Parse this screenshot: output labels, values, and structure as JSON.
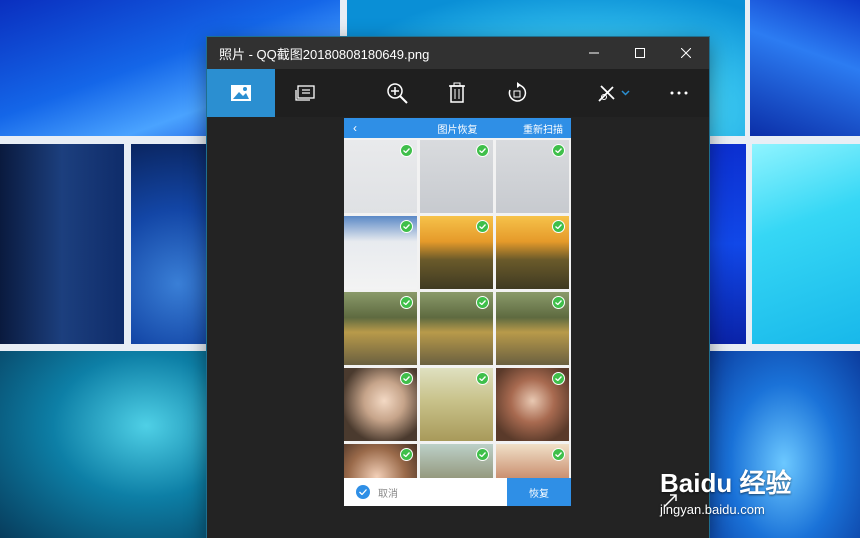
{
  "window": {
    "title": "照片 - QQ截图20180808180649.png",
    "controls": [
      "minimize",
      "maximize",
      "close"
    ]
  },
  "toolbar": {
    "items": [
      {
        "name": "photo-icon",
        "active": true
      },
      {
        "name": "slideshow-icon",
        "active": false
      },
      {
        "name": "zoom-in-icon",
        "active": false
      },
      {
        "name": "delete-icon",
        "active": false
      },
      {
        "name": "rotate-icon",
        "active": false
      },
      {
        "name": "edit-create-icon",
        "active": false
      },
      {
        "name": "more-icon",
        "active": false
      }
    ]
  },
  "phone": {
    "header": {
      "back": "‹",
      "title": "图片恢复",
      "rescan": "重新扫描"
    },
    "footer": {
      "cancel": "取消",
      "restore": "恢复"
    },
    "grid": [
      "img-ui1",
      "img-ui2",
      "img-ui2",
      "img-ui3",
      "img-sunset",
      "img-sunset",
      "img-car",
      "img-car",
      "img-car",
      "img-girl1",
      "img-wheat",
      "img-girl2",
      "img-girl3",
      "img-girl4",
      "img-girl5"
    ]
  },
  "watermark": {
    "logo": "Baidu 经验",
    "url": "jingyan.baidu.com"
  },
  "colors": {
    "accent": "#2b8fd1",
    "phone_blue": "#2f8fe6",
    "check_green": "#3fbf4a"
  }
}
